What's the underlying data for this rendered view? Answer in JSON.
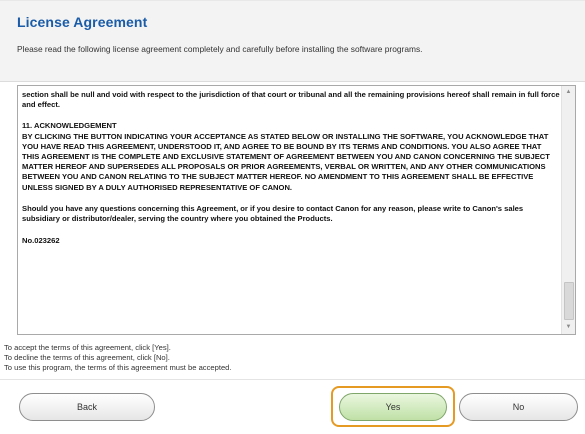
{
  "dialog": {
    "title": "License Agreement",
    "subtitle": "Please read the following license agreement completely and carefully before installing the software programs."
  },
  "license_text": {
    "p1": "section shall be null and void with respect to the jurisdiction of that court or tribunal and all the remaining provisions hereof shall remain in full force and effect.",
    "p2_heading": "11. ACKNOWLEDGEMENT",
    "p2_body": "BY CLICKING THE BUTTON INDICATING YOUR ACCEPTANCE AS STATED BELOW OR INSTALLING THE SOFTWARE, YOU ACKNOWLEDGE THAT YOU HAVE READ THIS AGREEMENT, UNDERSTOOD IT, AND AGREE TO BE BOUND BY ITS TERMS AND CONDITIONS. YOU ALSO AGREE THAT THIS AGREEMENT IS THE COMPLETE AND EXCLUSIVE STATEMENT OF AGREEMENT BETWEEN YOU AND CANON CONCERNING THE SUBJECT MATTER HEREOF AND SUPERSEDES ALL PROPOSALS OR PRIOR AGREEMENTS, VERBAL OR WRITTEN, AND ANY OTHER COMMUNICATIONS BETWEEN YOU AND CANON RELATING TO THE SUBJECT MATTER HEREOF. NO AMENDMENT TO THIS AGREEMENT SHALL BE EFFECTIVE UNLESS SIGNED BY A DULY AUTHORISED REPRESENTATIVE OF CANON.",
    "p3": "Should you have any questions concerning this Agreement, or if you desire to contact Canon for any reason, please write to Canon's sales subsidiary or distributor/dealer, serving the country where you obtained the Products.",
    "p4": "No.023262"
  },
  "instructions": {
    "line1": "To accept the terms of this agreement, click [Yes].",
    "line2": "To decline the terms of this agreement, click [No].",
    "line3": "To use this program, the terms of this agreement must be accepted."
  },
  "buttons": {
    "back": "Back",
    "yes": "Yes",
    "no": "No"
  },
  "scrollbar": {
    "up_glyph": "▲",
    "down_glyph": "▼"
  },
  "colors": {
    "title": "#1a5ca8",
    "focus_ring": "#e59a24",
    "yes_button": "#bfe0a6"
  }
}
